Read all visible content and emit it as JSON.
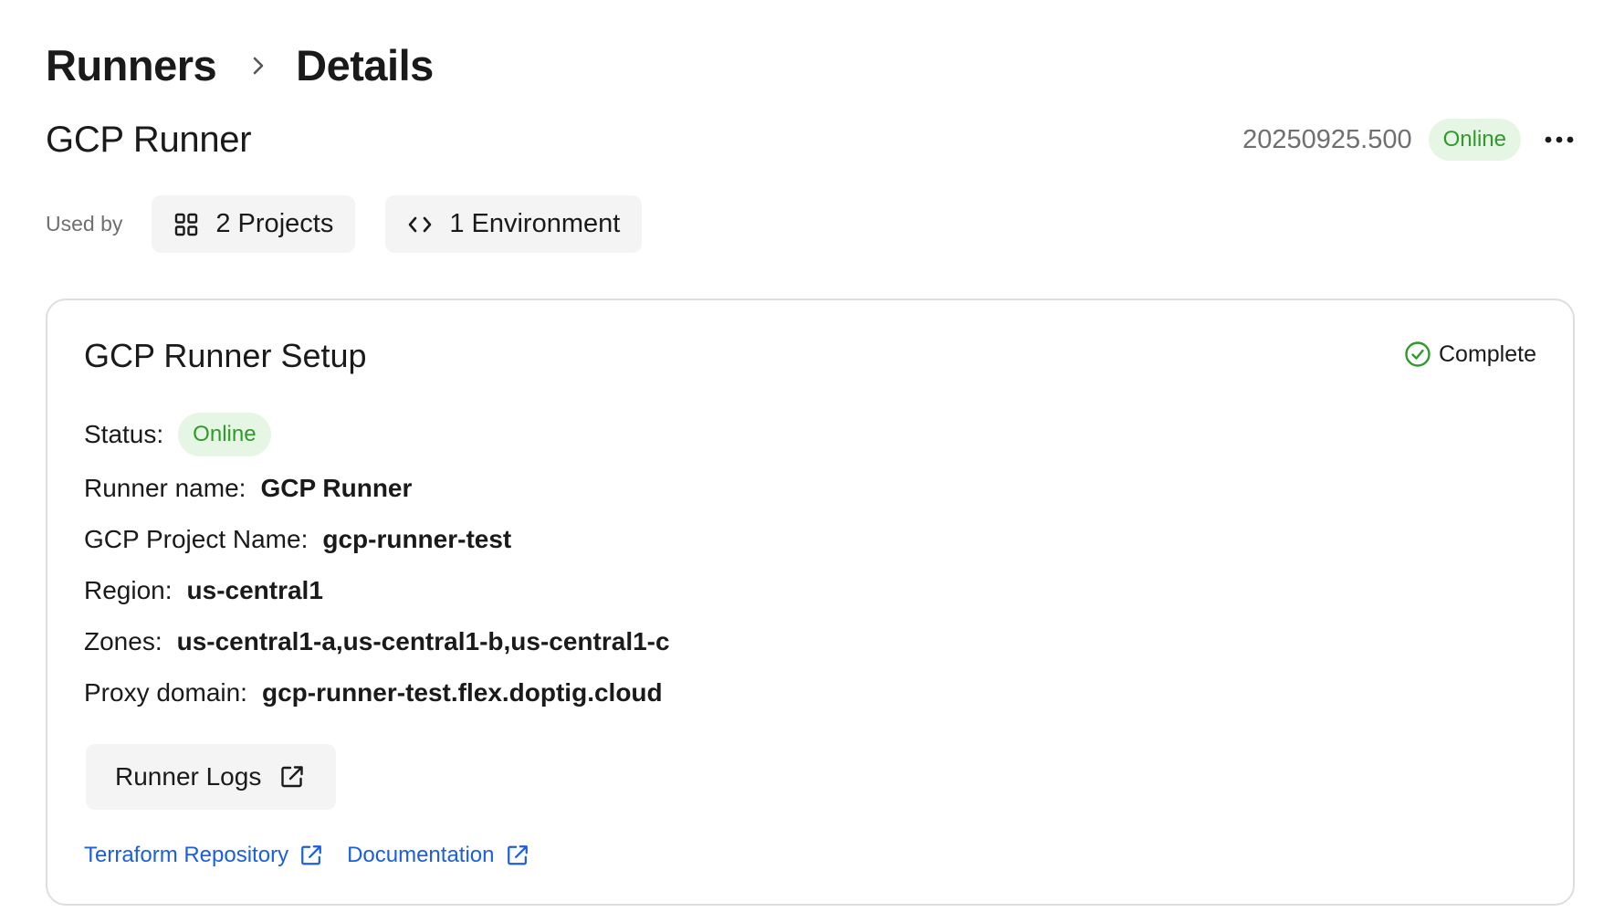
{
  "breadcrumb": {
    "root": "Runners",
    "current": "Details"
  },
  "header": {
    "title": "GCP Runner",
    "version": "20250925.500",
    "status": "Online"
  },
  "used_by": {
    "label": "Used by",
    "projects": "2 Projects",
    "environments": "1 Environment"
  },
  "setup": {
    "title": "GCP Runner Setup",
    "completion": "Complete",
    "status_label": "Status:",
    "status_value": "Online",
    "fields": [
      {
        "label": "Runner name:",
        "value": "GCP Runner"
      },
      {
        "label": "GCP Project Name:",
        "value": "gcp-runner-test"
      },
      {
        "label": "Region:",
        "value": "us-central1"
      },
      {
        "label": "Zones:",
        "value": "us-central1-a,us-central1-b,us-central1-c"
      },
      {
        "label": "Proxy domain:",
        "value": "gcp-runner-test.flex.doptig.cloud"
      }
    ],
    "logs_button": "Runner Logs",
    "links": {
      "terraform": "Terraform Repository",
      "documentation": "Documentation"
    }
  },
  "icons": {
    "breadcrumb_separator": "chevron-right-icon",
    "more": "more-horizontal-icon",
    "projects": "grid-icon",
    "environment": "code-icon",
    "complete": "check-circle-icon",
    "external": "external-link-icon"
  },
  "colors": {
    "online_text": "#2f9a2c",
    "online_bg": "#e6f6e4",
    "link": "#1b5fe0",
    "muted": "#6f6f6f"
  }
}
